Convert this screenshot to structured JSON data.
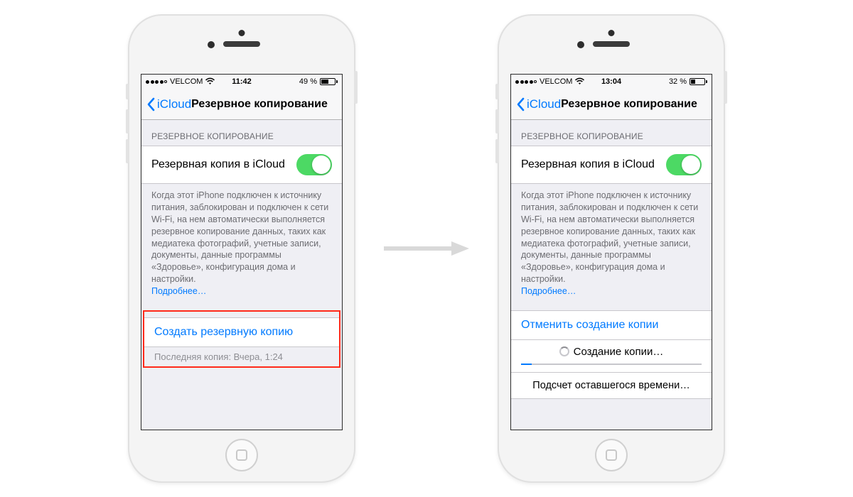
{
  "left": {
    "status": {
      "carrier": "VELCOM",
      "time": "11:42",
      "battery_text": "49 %",
      "battery_fill": 49
    },
    "nav": {
      "back": "iCloud",
      "title": "Резервное копирование"
    },
    "group_header": "РЕЗЕРВНОЕ КОПИРОВАНИЕ",
    "toggle_label": "Резервная копия в iCloud",
    "description": "Когда этот iPhone подключен к источнику питания, заблокирован и подключен к сети Wi-Fi, на нем автоматически выполняется резервное копирование данных, таких как медиатека фотографий, учетные записи, документы, данные программы «Здоровье», конфигурация дома и настройки.",
    "more": "Подробнее…",
    "action": "Создать резервную копию",
    "last_backup": "Последняя копия: Вчера, 1:24"
  },
  "right": {
    "status": {
      "carrier": "VELCOM",
      "time": "13:04",
      "battery_text": "32 %",
      "battery_fill": 32
    },
    "nav": {
      "back": "iCloud",
      "title": "Резервное копирование"
    },
    "group_header": "РЕЗЕРВНОЕ КОПИРОВАНИЕ",
    "toggle_label": "Резервная копия в iCloud",
    "description": "Когда этот iPhone подключен к источнику питания, заблокирован и подключен к сети Wi-Fi, на нем автоматически выполняется резервное копирование данных, таких как медиатека фотографий, учетные записи, документы, данные программы «Здоровье», конфигурация дома и настройки.",
    "more": "Подробнее…",
    "action": "Отменить создание копии",
    "progress_label": "Создание копии…",
    "estimate": "Подсчет оставшегося времени…"
  }
}
